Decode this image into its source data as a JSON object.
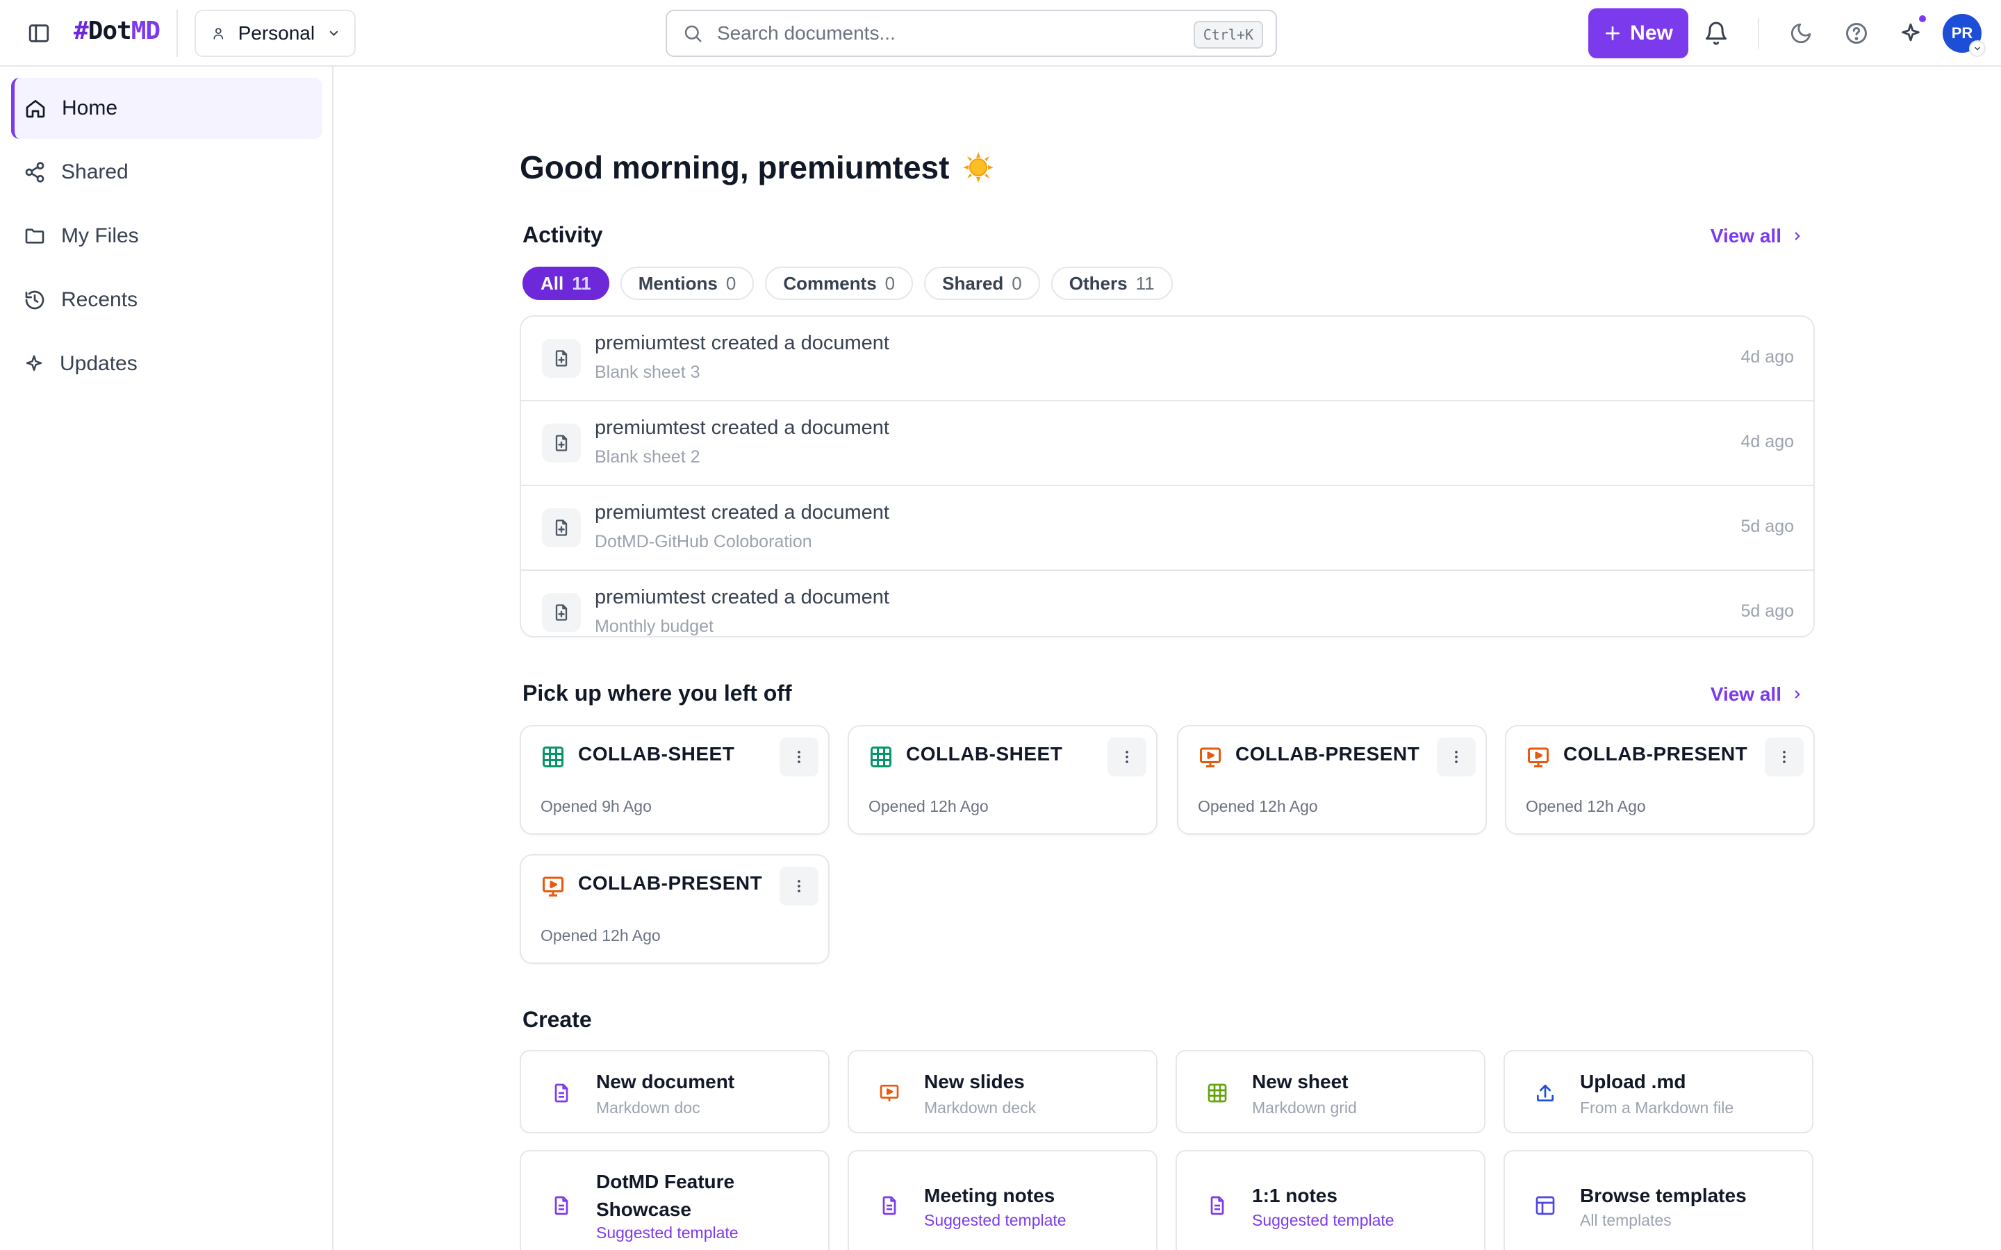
{
  "header": {
    "logo_hash": "#",
    "logo_dot": "Dot",
    "logo_md": "MD",
    "workspace": "Personal",
    "search_placeholder": "Search documents...",
    "search_shortcut": "Ctrl+K",
    "new_label": "New",
    "avatar_initials": "PR"
  },
  "sidebar": {
    "items": [
      {
        "label": "Home",
        "icon": "home-icon"
      },
      {
        "label": "Shared",
        "icon": "share-icon"
      },
      {
        "label": "My Files",
        "icon": "folder-icon"
      },
      {
        "label": "Recents",
        "icon": "history-icon"
      },
      {
        "label": "Updates",
        "icon": "sparkle-icon"
      }
    ]
  },
  "main": {
    "greeting": "Good morning, premiumtest",
    "activity": {
      "title": "Activity",
      "view_all": "View all",
      "filters": [
        {
          "label": "All",
          "count": "11"
        },
        {
          "label": "Mentions",
          "count": "0"
        },
        {
          "label": "Comments",
          "count": "0"
        },
        {
          "label": "Shared",
          "count": "0"
        },
        {
          "label": "Others",
          "count": "11"
        }
      ],
      "items": [
        {
          "title": "premiumtest created a document",
          "doc": "Blank sheet 3",
          "time": "4d ago"
        },
        {
          "title": "premiumtest created a document",
          "doc": "Blank sheet 2",
          "time": "4d ago"
        },
        {
          "title": "premiumtest created a document",
          "doc": "DotMD-GitHub Coloboration",
          "time": "5d ago"
        },
        {
          "title": "premiumtest created a document",
          "doc": "Monthly budget",
          "time": "5d ago"
        }
      ]
    },
    "recent": {
      "title": "Pick up where you left off",
      "view_all": "View all",
      "items": [
        {
          "name": "COLLAB-SHEET",
          "opened": "Opened 9h Ago",
          "type": "sheet"
        },
        {
          "name": "COLLAB-SHEET",
          "opened": "Opened 12h Ago",
          "type": "sheet"
        },
        {
          "name": "COLLAB-PRESENT",
          "opened": "Opened 12h Ago",
          "type": "slides"
        },
        {
          "name": "COLLAB-PRESENT",
          "opened": "Opened 12h Ago",
          "type": "slides"
        },
        {
          "name": "COLLAB-PRESENT",
          "opened": "Opened 12h Ago",
          "type": "slides"
        }
      ]
    },
    "create": {
      "title": "Create",
      "items": [
        {
          "title": "New document",
          "subtitle": "Markdown doc",
          "icon": "document-icon"
        },
        {
          "title": "New slides",
          "subtitle": "Markdown deck",
          "icon": "slides-icon"
        },
        {
          "title": "New sheet",
          "subtitle": "Markdown grid",
          "icon": "sheet-icon"
        },
        {
          "title": "Upload .md",
          "subtitle": "From a Markdown file",
          "icon": "upload-icon"
        },
        {
          "title": "DotMD Feature Showcase",
          "subtitle": "Suggested template",
          "icon": "document-icon"
        },
        {
          "title": "Meeting notes",
          "subtitle": "Suggested template",
          "icon": "document-icon"
        },
        {
          "title": "1:1 notes",
          "subtitle": "Suggested template",
          "icon": "document-icon"
        },
        {
          "title": "Browse templates",
          "subtitle": "All templates",
          "icon": "template-icon"
        }
      ]
    }
  },
  "colors": {
    "accent": "#7c3aed",
    "sheet": "#059669",
    "slides": "#ea580c",
    "upload": "#1d4ed8"
  }
}
